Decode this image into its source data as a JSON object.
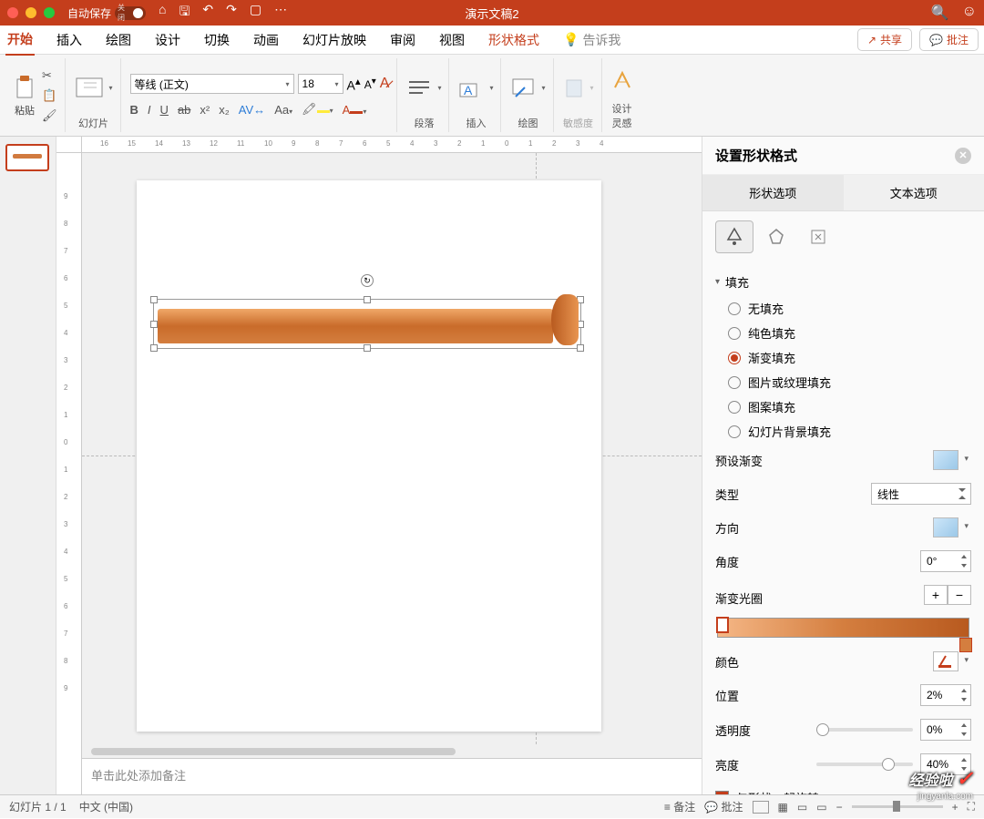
{
  "titlebar": {
    "autosave_label": "自动保存",
    "autosave_state": "关闭",
    "doc_title": "演示文稿2"
  },
  "tabs": {
    "home": "开始",
    "insert": "插入",
    "draw": "绘图",
    "design": "设计",
    "transition": "切换",
    "animation": "动画",
    "slideshow": "幻灯片放映",
    "review": "审阅",
    "view": "视图",
    "shape_format": "形状格式",
    "tell_me": "告诉我",
    "share": "共享",
    "comments": "批注"
  },
  "ribbon": {
    "paste": "粘贴",
    "slides": "幻灯片",
    "font_name": "等线 (正文)",
    "font_size": "18",
    "paragraph": "段落",
    "insert": "插入",
    "drawing": "绘图",
    "sensitivity": "敏感度",
    "design_ideas": "设计\n灵感"
  },
  "notes_placeholder": "单击此处添加备注",
  "pane": {
    "title": "设置形状格式",
    "tab_shape": "形状选项",
    "tab_text": "文本选项",
    "section_fill": "填充",
    "fill_none": "无填充",
    "fill_solid": "纯色填充",
    "fill_gradient": "渐变填充",
    "fill_picture": "图片或纹理填充",
    "fill_pattern": "图案填充",
    "fill_slide_bg": "幻灯片背景填充",
    "preset_gradient": "预设渐变",
    "type_label": "类型",
    "type_value": "线性",
    "direction": "方向",
    "angle": "角度",
    "angle_value": "0°",
    "gradient_stops": "渐变光圈",
    "color": "颜色",
    "position": "位置",
    "position_value": "2%",
    "transparency": "透明度",
    "transparency_value": "0%",
    "brightness": "亮度",
    "brightness_value": "40%",
    "rotate_with_shape": "与形状一起旋转"
  },
  "status": {
    "slide_counter": "幻灯片 1 / 1",
    "language": "中文 (中国)",
    "notes_btn": "备注",
    "comments_btn": "批注"
  },
  "watermark": {
    "main": "经验啦",
    "sub": "jingyanla.com"
  }
}
